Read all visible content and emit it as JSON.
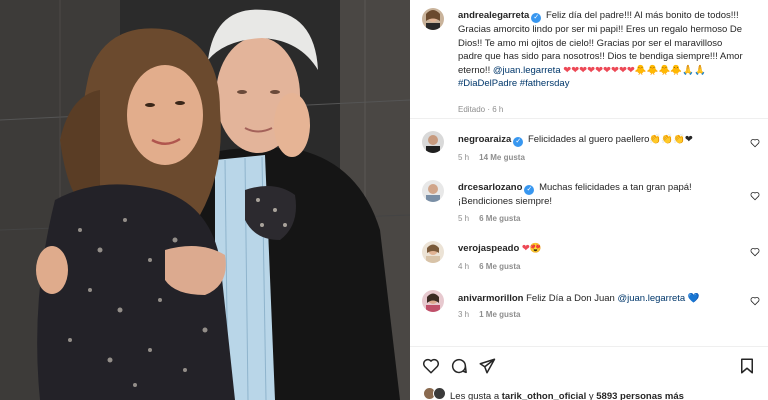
{
  "post": {
    "username": "andrealegarreta",
    "caption_text": "Feliz día del padre!!! Al más bonito de todos!!! Gracias amorcito lindo por ser mi papi!! Eres un regalo hermoso De Dios!! Te amo mi ojitos de cielo!! Gracias por ser el maravilloso padre que has sido para nosotros!! Dios te bendiga siempre!!! Amor eterno!!",
    "mention": "@juan.legarreta",
    "caption_emojis": "❤❤❤❤❤❤❤❤❤🐥🐥🐥🐥🙏🙏",
    "hashtag_1": "#DiaDelPadre",
    "hashtag_2": "#fathersday",
    "edited": "Editado · 6 h"
  },
  "comments": [
    {
      "username": "negroaraiza",
      "text": "Felicidades al guero paellero👏👏👏❤",
      "time": "5 h",
      "likes": "14 Me gusta"
    },
    {
      "username": "drcesarlozano",
      "text": "Muchas felicidades a tan gran papá! ¡Bendiciones siempre!",
      "time": "5 h",
      "likes": "6 Me gusta"
    },
    {
      "username": "verojaspeado",
      "text": "❤😍",
      "time": "4 h",
      "likes": "6 Me gusta"
    },
    {
      "username": "anivarmorillon",
      "text": "Feliz Día a Don Juan",
      "mention": "@juan.legarreta",
      "text_end": "💙",
      "time": "3 h",
      "likes": "1 Me gusta"
    }
  ],
  "likes_bar": {
    "prefix": "Les gusta a",
    "user": "tarik_othon_oficial",
    "middle": "y",
    "count": "5893 personas más"
  },
  "icons": [
    "verified-badge-icon",
    "heart-icon",
    "comment-icon",
    "share-icon",
    "bookmark-icon"
  ],
  "colors": {
    "verified": "#3897f0",
    "link": "#00376b",
    "heart": "#ed4956",
    "meta": "#8e8e8e"
  }
}
